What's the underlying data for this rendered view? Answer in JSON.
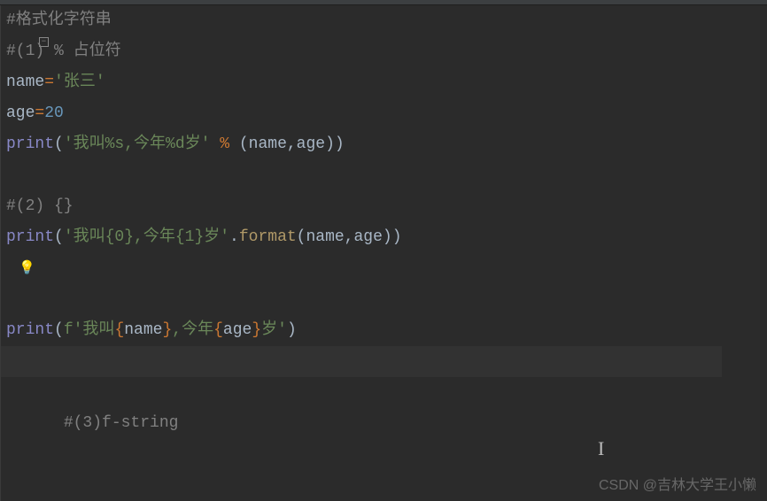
{
  "lines": {
    "l1_comment": "#格式化字符串",
    "l2_comment": "#(1) % 占位符",
    "l3_name": "name",
    "l3_eq": "=",
    "l3_val": "'张三'",
    "l4_name": "age",
    "l4_eq": "=",
    "l4_val": "20",
    "l5_print": "print",
    "l5_paren1": "(",
    "l5_str": "'我叫%s,今年%d岁' ",
    "l5_pct": "%",
    "l5_args": " (name,age))",
    "l7_comment": "#(2) {}",
    "l8_print": "print",
    "l8_paren1": "(",
    "l8_str": "'我叫{0},今年{1}岁'",
    "l8_dot": ".",
    "l8_format": "format",
    "l8_args": "(name,age))",
    "l10_comment": "#(3)f-string",
    "l11_print": "print",
    "l11_paren1": "(",
    "l11_fstr1": "f'我叫",
    "l11_brace1": "{",
    "l11_var1": "name",
    "l11_brace2": "}",
    "l11_fstr2": ",今年",
    "l11_brace3": "{",
    "l11_var2": "age",
    "l11_brace4": "}",
    "l11_fstr3": "岁'",
    "l11_paren2": ")"
  },
  "fold_marker": "−",
  "bulb": "💡",
  "text_cursor": "I",
  "watermark": "CSDN @吉林大学王小懒"
}
